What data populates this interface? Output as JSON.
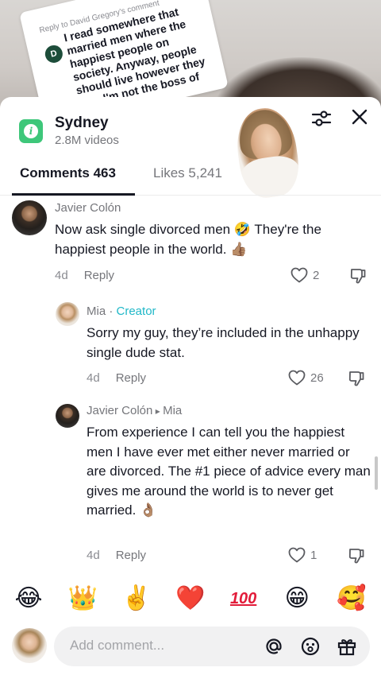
{
  "reply_card": {
    "reply_to": "Reply to David Gregory's comment",
    "avatar_letter": "D",
    "text": "I read somewhere that married men where the happiest people on society. Anyway, people should live however they like, I'm not the boss of anyone's life!"
  },
  "header": {
    "title": "Sydney",
    "subtitle": "2.8M videos"
  },
  "tabs": {
    "comments": "Comments 463",
    "likes": "Likes 5,241"
  },
  "comments": [
    {
      "author": "Javier Colón",
      "text": "Now ask single divorced men 🤣 They're the happiest people in the world. 👍🏽",
      "age": "4d",
      "reply_label": "Reply",
      "likes": "2"
    },
    {
      "author": "Mia",
      "separator": " · ",
      "badge": "Creator",
      "text": "Sorry my guy, they’re included in the unhappy single dude stat.",
      "age": "4d",
      "reply_label": "Reply",
      "likes": "26"
    },
    {
      "author": "Javier Colón",
      "reply_to_arrow": " ▸ ",
      "reply_to": "Mia",
      "text": "From experience I can tell you the happiest men I have ever met either never married or are divorced. The #1 piece of advice every man gives me around the world is to never get married. 👌🏽",
      "age": "4d",
      "reply_label": "Reply",
      "likes": "1"
    }
  ],
  "emoji_bar": [
    "😂",
    "👑",
    "✌️",
    "❤️",
    "100",
    "😁",
    "🥰"
  ],
  "input": {
    "placeholder": "Add comment..."
  },
  "colors": {
    "creator_badge": "#20b8c8",
    "logo": "#3ec77a",
    "hundred": "#e21c3a"
  }
}
